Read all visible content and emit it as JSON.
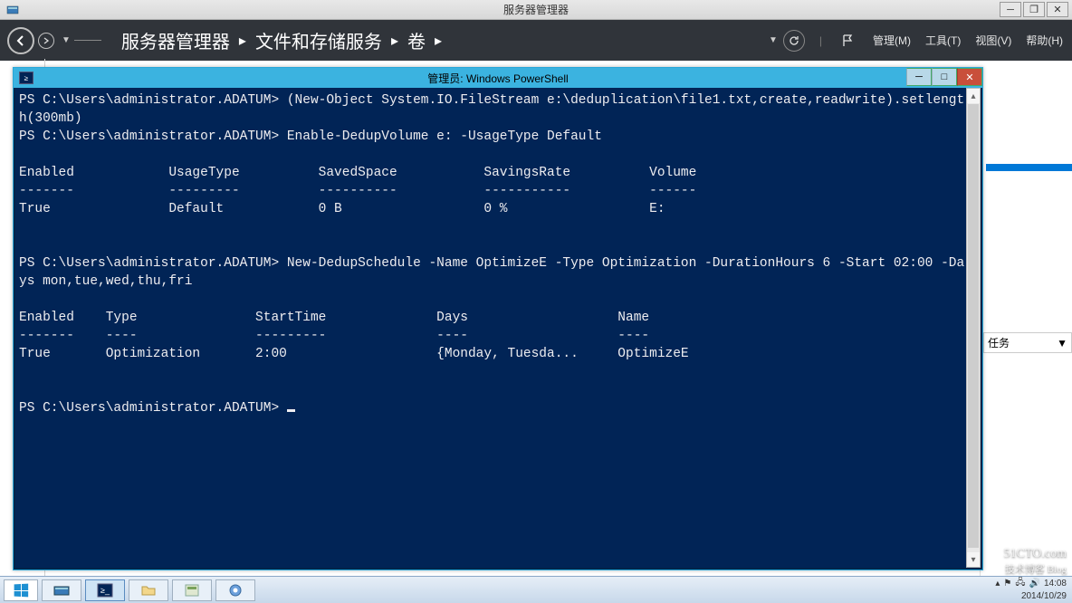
{
  "outer": {
    "title": "服务器管理器",
    "win_min": "─",
    "win_max": "❐",
    "win_close": "✕"
  },
  "appbar": {
    "crumb1": "服务器管理器",
    "crumb2": "文件和存储服务",
    "crumb3": "卷",
    "sep": "▸",
    "menu_manage": "管理(M)",
    "menu_tools": "工具(T)",
    "menu_view": "视图(V)",
    "menu_help": "帮助(H)"
  },
  "right_panel": {
    "highlight": " ",
    "tasks_label": "任务",
    "tasks_arrow": "▼"
  },
  "ps": {
    "title": "管理员: Windows PowerShell",
    "min": "─",
    "max": "□",
    "close": "✕",
    "content": "PS C:\\Users\\administrator.ADATUM> (New-Object System.IO.FileStream e:\\deduplication\\file1.txt,create,readwrite).setlengt\nh(300mb)\nPS C:\\Users\\administrator.ADATUM> Enable-DedupVolume e: -UsageType Default\n\nEnabled            UsageType          SavedSpace           SavingsRate          Volume\n-------            ---------          ----------           -----------          ------\nTrue               Default            0 B                  0 %                  E:\n\n\nPS C:\\Users\\administrator.ADATUM> New-DedupSchedule -Name OptimizeE -Type Optimization -DurationHours 6 -Start 02:00 -Da\nys mon,tue,wed,thu,fri\n\nEnabled    Type               StartTime              Days                   Name\n-------    ----               ---------              ----                   ----\nTrue       Optimization       2:00                   {Monday, Tuesda...     OptimizeE\n\n\nPS C:\\Users\\administrator.ADATUM> "
  },
  "tray": {
    "time": "14:08",
    "date": "2014/10/29"
  },
  "watermark": {
    "l1": "51CTO.com",
    "l2": "技术博客   Blog"
  }
}
